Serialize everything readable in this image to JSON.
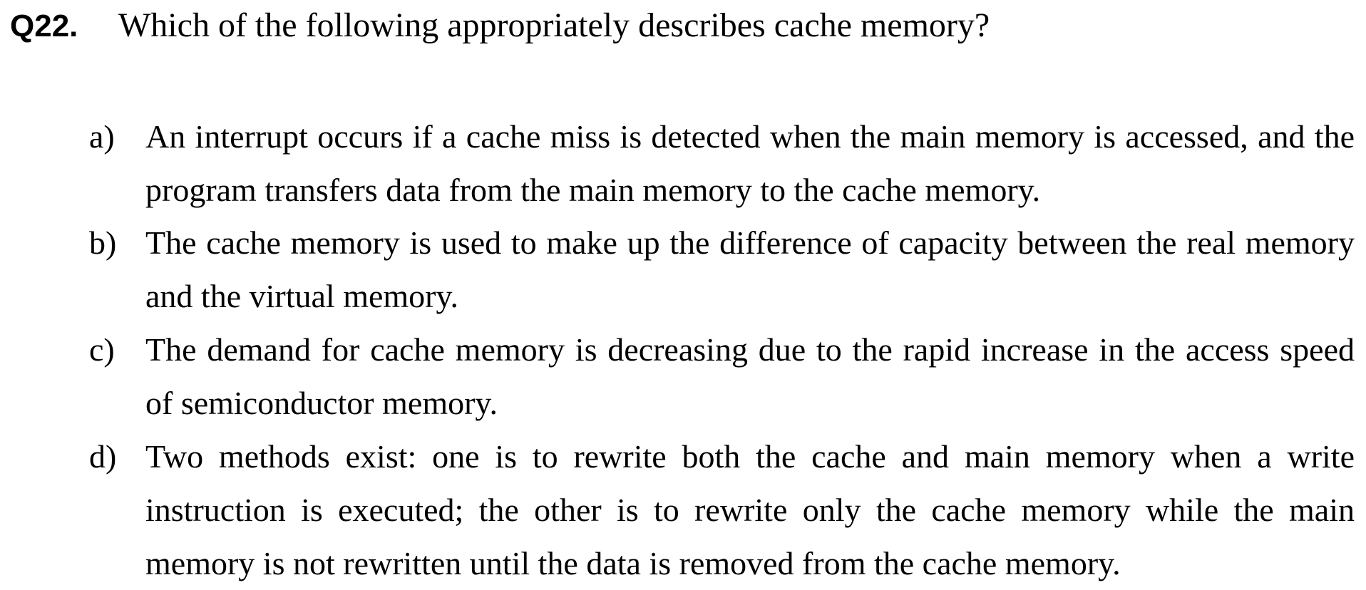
{
  "question": {
    "number": "Q22.",
    "text": "Which of the following appropriately describes cache memory?"
  },
  "options": [
    {
      "label": "a)",
      "text": "An interrupt occurs if a cache miss is detected when the main memory is accessed, and the program transfers data from the main memory to the cache memory."
    },
    {
      "label": "b)",
      "text": "The cache memory is used to make up the difference of capacity between the real memory and the virtual memory."
    },
    {
      "label": "c)",
      "text": "The demand for cache memory is decreasing due to the rapid increase in the access speed of semiconductor memory."
    },
    {
      "label": "d)",
      "text": "Two methods exist: one is to rewrite both the cache and main memory when a write instruction is executed; the other is to rewrite only the cache memory while the main memory is not rewritten until the data is removed from the cache memory."
    }
  ]
}
